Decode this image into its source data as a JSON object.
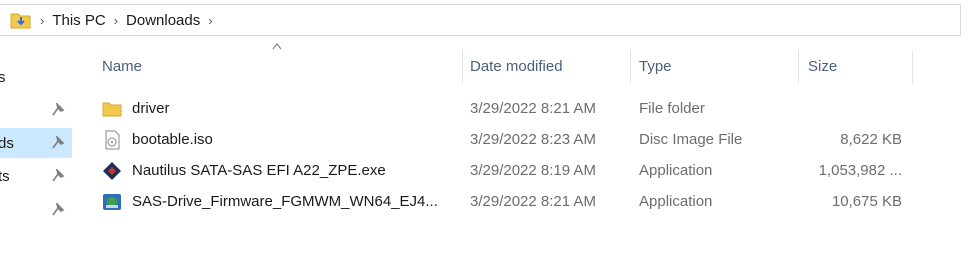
{
  "breadcrumb": {
    "items": [
      "This PC",
      "Downloads"
    ],
    "separator": "›"
  },
  "nav_pane": {
    "items": [
      {
        "label": "s",
        "pinned": false,
        "selected": false
      },
      {
        "label": "",
        "pinned": true,
        "selected": false
      },
      {
        "label": "ds",
        "pinned": true,
        "selected": true
      },
      {
        "label": "ts",
        "pinned": true,
        "selected": false
      },
      {
        "label": "",
        "pinned": true,
        "selected": false
      }
    ]
  },
  "columns": {
    "name": "Name",
    "date": "Date modified",
    "type": "Type",
    "size": "Size"
  },
  "files": [
    {
      "name": "driver",
      "date": "3/29/2022 8:21 AM",
      "type": "File folder",
      "size": "",
      "icon": "folder-icon"
    },
    {
      "name": "bootable.iso",
      "date": "3/29/2022 8:23 AM",
      "type": "Disc Image File",
      "size": "8,622 KB",
      "icon": "disc-image-icon"
    },
    {
      "name": "Nautilus SATA-SAS EFI A22_ZPE.exe",
      "date": "3/29/2022 8:19 AM",
      "type": "Application",
      "size": "1,053,982 ...",
      "icon": "nautilus-app-icon"
    },
    {
      "name": "SAS-Drive_Firmware_FGMWM_WN64_EJ4...",
      "date": "3/29/2022 8:21 AM",
      "type": "Application",
      "size": "10,675 KB",
      "icon": "firmware-app-icon"
    }
  ],
  "colors": {
    "selection": "#cce8ff",
    "header_text": "#4c607a",
    "folder": "#f2c94c"
  }
}
